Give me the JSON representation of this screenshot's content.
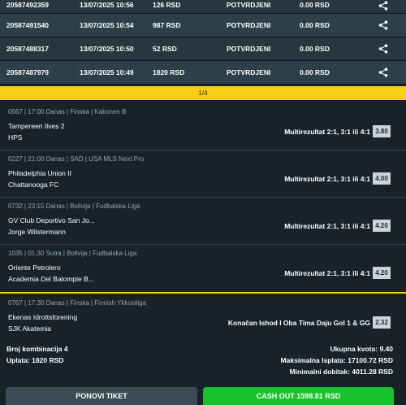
{
  "tickets": [
    {
      "id": "20587492359",
      "date": "13/07/2025 10:56",
      "amount": "126 RSD",
      "status": "POTVRDJENI",
      "win": "0.00 RSD"
    },
    {
      "id": "20587491540",
      "date": "13/07/2025 10:54",
      "amount": "987 RSD",
      "status": "POTVRDJENI",
      "win": "0.00 RSD"
    },
    {
      "id": "20587488317",
      "date": "13/07/2025 10:50",
      "amount": "52 RSD",
      "status": "POTVRDJENI",
      "win": "0.00 RSD"
    },
    {
      "id": "20587487979",
      "date": "13/07/2025 10:49",
      "amount": "1820 RSD",
      "status": "POTVRDJENI",
      "win": "0.00 RSD"
    }
  ],
  "pager": "1/4",
  "matches": [
    {
      "header": "0567 | 17:00 Danas | Finska | Kakonen B",
      "team1": "Tampereen Ilves 2",
      "team2": "HPS",
      "pick": "Multirezultat 2:1, 3:1 ili 4:1",
      "odd": "3.80"
    },
    {
      "header": "0227 | 21:00 Danas | SAD | USA MLS Next Pro",
      "team1": "Philadelphia Union II",
      "team2": "Chattanooga FC",
      "pick": "Multirezultat 2:1, 3:1 ili 4:1",
      "odd": "4.00"
    },
    {
      "header": "0732 | 23:15 Danas | Bolivija | Fudbalska Liga",
      "team1": "GV Club Deportivo San Jo...",
      "team2": "Jorge Wilstermann",
      "pick": "Multirezultat 2:1, 3:1 ili 4:1",
      "odd": "4.20"
    },
    {
      "header": "1035 | 01:30 Sutra | Bolivija | Fudbalska Liga",
      "team1": "Oriente Petrolero",
      "team2": "Academia Del Balompie B...",
      "pick": "Multirezultat 2:1, 3:1 ili 4:1",
      "odd": "4.20"
    },
    {
      "header": "0767 | 17:30 Danas | Finska | Finnish Ykkosliiga",
      "team1": "Ekenas Idrottsforening",
      "team2": "SJK Akatemia",
      "pick": "Konačan Ishod I Oba Tima Daju Gol 1 & GG",
      "odd": "2.32"
    }
  ],
  "summary": {
    "combinations": "Broj kombinacija 4",
    "stake": "Uplata: 1820 RSD",
    "total_odds": "Ukupna kvota: 9.40",
    "max_payout": "Maksimalna Isplata: 17100.72 RSD",
    "min_win": "Minimalni dobitak: 4011.28 RSD"
  },
  "buttons": {
    "repeat": "PONOVI TIKET",
    "cashout": "CASH OUT 1598.81 RSD"
  },
  "icons": {
    "share": "share-icon"
  },
  "colors": {
    "accent_yellow": "#f7cf16",
    "cashout_green": "#18c22a",
    "background": "#172229"
  }
}
